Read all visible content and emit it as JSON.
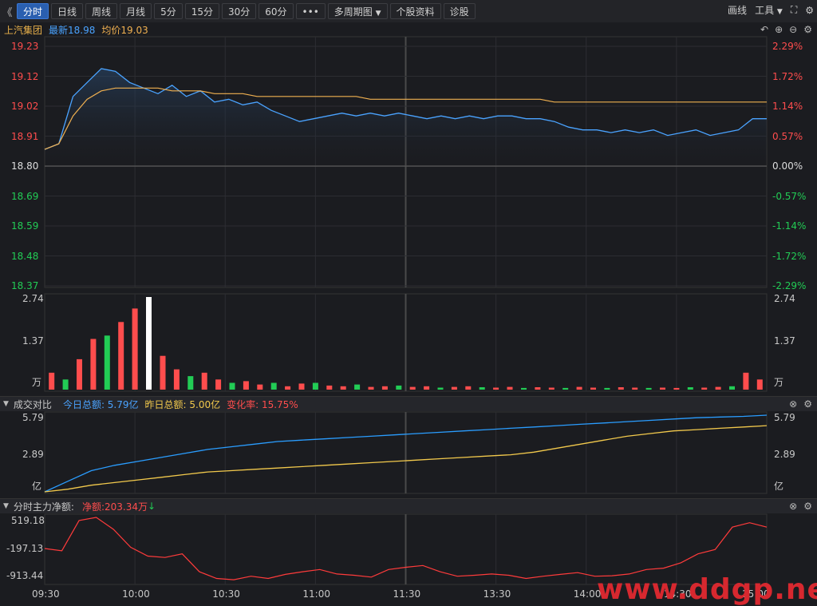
{
  "toolbar": {
    "nav_back": "《",
    "tabs": [
      "分时",
      "日线",
      "周线",
      "月线",
      "5分",
      "15分",
      "30分",
      "60分"
    ],
    "active_tab": "分时",
    "more": "•••",
    "multi_period": "多周期图",
    "multi_period_arrow": "▼",
    "stock_info": "个股资料",
    "diagnose": "诊股",
    "draw_line": "画线",
    "tools": "工具",
    "tools_arrow": "▼",
    "expand_icon": "⛶",
    "settings_icon": "⚙"
  },
  "stock": {
    "name": "上汽集团",
    "latest": "最新18.98",
    "avg": "均价19.03"
  },
  "price_axis": {
    "left": [
      "19.23",
      "19.12",
      "19.02",
      "18.91",
      "18.80",
      "18.69",
      "18.59",
      "18.48",
      "18.37"
    ],
    "right": [
      "2.29%",
      "1.72%",
      "1.14%",
      "0.57%",
      "0.00%",
      "-0.57%",
      "-1.14%",
      "-1.72%",
      "-2.29%"
    ]
  },
  "volume_axis": {
    "top": "2.74",
    "mid": "1.37",
    "unit": "万"
  },
  "compare_panel": {
    "title": "成交对比",
    "today": "今日总额: 5.79亿",
    "yesterday": "昨日总额: 5.00亿",
    "change": "变化率: 15.75%",
    "axis_top": "5.79",
    "axis_mid": "2.89",
    "unit": "亿"
  },
  "flow_panel": {
    "title": "分时主力净额:",
    "net": "净额:203.34万",
    "arrow": "↓",
    "axis": [
      "519.18",
      "-197.13",
      "-913.44"
    ]
  },
  "time_axis": [
    "09:30",
    "10:00",
    "10:30",
    "11:00",
    "11:30",
    "13:30",
    "14:00",
    "14:30",
    "15:00"
  ],
  "watermark": "www.ddgp.net",
  "colors": {
    "price_line": "#4aa3ff",
    "avg_line": "#f0b050",
    "up": "#ff4d4d",
    "down": "#22cc55",
    "today": "#2a9dff",
    "yesterday": "#f2c94c",
    "flow": "#ff3b3b"
  },
  "chart_data": [
    {
      "type": "line",
      "title": "",
      "ylim": [
        18.37,
        19.23
      ],
      "series": [
        {
          "name": "最新",
          "values": [
            18.86,
            18.88,
            19.05,
            19.1,
            19.15,
            19.14,
            19.1,
            19.08,
            19.06,
            19.09,
            19.05,
            19.07,
            19.03,
            19.04,
            19.02,
            19.03,
            19.0,
            18.98,
            18.96,
            18.97,
            18.98,
            18.99,
            18.98,
            18.99,
            18.98,
            18.99,
            18.98,
            18.97,
            18.98,
            18.97,
            18.98,
            18.97,
            18.98,
            18.98,
            18.97,
            18.97,
            18.96,
            18.94,
            18.93,
            18.93,
            18.92,
            18.93,
            18.92,
            18.93,
            18.91,
            18.92,
            18.93,
            18.91,
            18.92,
            18.93,
            18.97,
            18.97
          ]
        },
        {
          "name": "均价",
          "values": [
            18.86,
            18.88,
            18.98,
            19.04,
            19.07,
            19.08,
            19.08,
            19.08,
            19.08,
            19.07,
            19.07,
            19.07,
            19.06,
            19.06,
            19.06,
            19.05,
            19.05,
            19.05,
            19.05,
            19.05,
            19.05,
            19.05,
            19.05,
            19.04,
            19.04,
            19.04,
            19.04,
            19.04,
            19.04,
            19.04,
            19.04,
            19.04,
            19.04,
            19.04,
            19.04,
            19.04,
            19.03,
            19.03,
            19.03,
            19.03,
            19.03,
            19.03,
            19.03,
            19.03,
            19.03,
            19.03,
            19.03,
            19.03,
            19.03,
            19.03,
            19.03,
            19.03
          ]
        }
      ]
    },
    {
      "type": "bar",
      "title": "",
      "ylim": [
        0,
        2.74
      ],
      "values": [
        0.5,
        0.3,
        0.9,
        1.5,
        1.6,
        2.0,
        2.4,
        2.74,
        1.0,
        0.6,
        0.4,
        0.5,
        0.3,
        0.2,
        0.25,
        0.15,
        0.2,
        0.1,
        0.18,
        0.2,
        0.12,
        0.1,
        0.15,
        0.08,
        0.1,
        0.12,
        0.08,
        0.1,
        0.06,
        0.08,
        0.1,
        0.07,
        0.06,
        0.08,
        0.05,
        0.07,
        0.06,
        0.05,
        0.08,
        0.06,
        0.05,
        0.07,
        0.06,
        0.05,
        0.06,
        0.05,
        0.07,
        0.06,
        0.08,
        0.1,
        0.5,
        0.3
      ]
    },
    {
      "type": "line",
      "title": "",
      "ylim": [
        0,
        5.79
      ],
      "series": [
        {
          "name": "今日总额",
          "values": [
            0,
            0.8,
            1.6,
            2.0,
            2.3,
            2.6,
            2.9,
            3.2,
            3.4,
            3.6,
            3.8,
            3.9,
            4.0,
            4.1,
            4.2,
            4.3,
            4.4,
            4.5,
            4.6,
            4.7,
            4.8,
            4.9,
            5.0,
            5.1,
            5.2,
            5.3,
            5.4,
            5.5,
            5.6,
            5.65,
            5.7,
            5.79
          ]
        },
        {
          "name": "昨日总额",
          "values": [
            0,
            0.2,
            0.5,
            0.7,
            0.9,
            1.1,
            1.3,
            1.5,
            1.6,
            1.7,
            1.8,
            1.9,
            2.0,
            2.1,
            2.2,
            2.3,
            2.4,
            2.5,
            2.6,
            2.7,
            2.8,
            3.0,
            3.3,
            3.6,
            3.9,
            4.2,
            4.4,
            4.6,
            4.7,
            4.8,
            4.9,
            5.0
          ]
        }
      ]
    },
    {
      "type": "line",
      "title": "",
      "ylim": [
        -913.44,
        519.18
      ],
      "series": [
        {
          "name": "主力净额",
          "values": [
            -180,
            -230,
            450,
            519,
            250,
            -150,
            -350,
            -380,
            -300,
            -700,
            -850,
            -880,
            -800,
            -850,
            -760,
            -700,
            -650,
            -750,
            -780,
            -820,
            -650,
            -600,
            -560,
            -700,
            -800,
            -780,
            -750,
            -780,
            -850,
            -800,
            -760,
            -720,
            -800,
            -790,
            -750,
            -650,
            -620,
            -500,
            -300,
            -200,
            300,
            400,
            300
          ]
        }
      ]
    }
  ]
}
